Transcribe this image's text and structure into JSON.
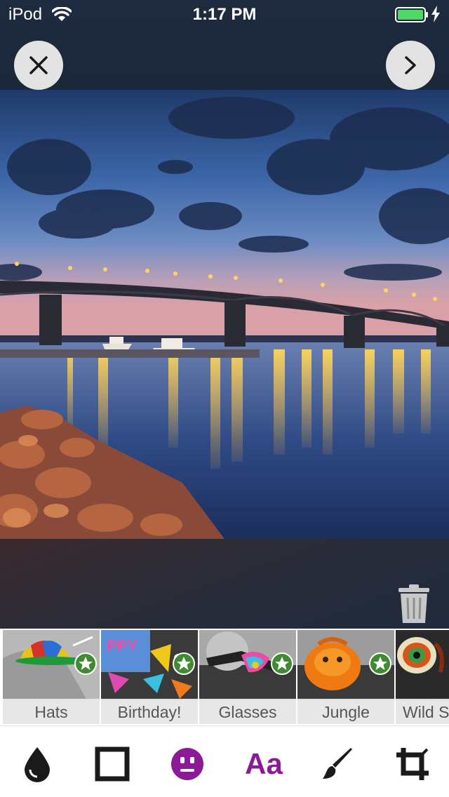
{
  "status_bar": {
    "carrier": "iPod",
    "time": "1:17 PM"
  },
  "header": {
    "close_icon": "close-icon",
    "next_icon": "chevron-right-icon"
  },
  "photo": {
    "description_icon": "bridge-night-photo"
  },
  "stickers": [
    {
      "label": "Hats"
    },
    {
      "label": "Birthday!"
    },
    {
      "label": "Glasses"
    },
    {
      "label": "Jungle"
    },
    {
      "label": "Wild S"
    }
  ],
  "toolbar": {
    "text_tool_label": "Aa",
    "active_color": "#8a1a96"
  },
  "colors": {
    "badge_green": "#3f8a32",
    "accent_purple": "#8a1a96"
  }
}
